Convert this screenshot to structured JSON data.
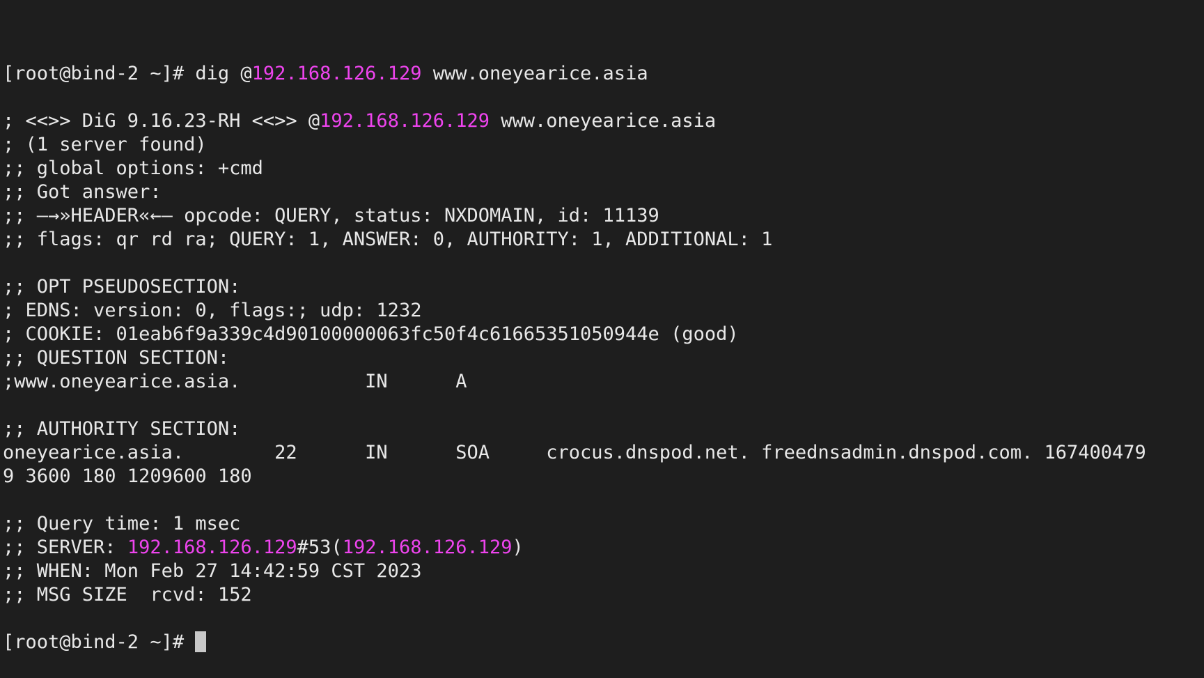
{
  "colors": {
    "background": "#1e1e1e",
    "text": "#e8e8e8",
    "ip_highlight": "#ee44ee",
    "cursor": "#c8c8c8"
  },
  "terminal": {
    "lines": [
      [
        {
          "t": "[root@bind-2 ~]# dig @"
        },
        {
          "t": "192.168.126.129",
          "c": "ip"
        },
        {
          "t": " www.oneyearice.asia"
        }
      ],
      [],
      [
        {
          "t": "; <<>> DiG 9.16.23-RH <<>> @"
        },
        {
          "t": "192.168.126.129",
          "c": "ip"
        },
        {
          "t": " www.oneyearice.asia"
        }
      ],
      [
        {
          "t": "; (1 server found)"
        }
      ],
      [
        {
          "t": ";; global options: +cmd"
        }
      ],
      [
        {
          "t": ";; Got answer:"
        }
      ],
      [
        {
          "t": ";; —→»HEADER«←— opcode: QUERY, status: NXDOMAIN, id: 11139"
        }
      ],
      [
        {
          "t": ";; flags: qr rd ra; QUERY: 1, ANSWER: 0, AUTHORITY: 1, ADDITIONAL: 1"
        }
      ],
      [],
      [
        {
          "t": ";; OPT PSEUDOSECTION:"
        }
      ],
      [
        {
          "t": "; EDNS: version: 0, flags:; udp: 1232"
        }
      ],
      [
        {
          "t": "; COOKIE: 01eab6f9a339c4d90100000063fc50f4c61665351050944e (good)"
        }
      ],
      [
        {
          "t": ";; QUESTION SECTION:"
        }
      ],
      [
        {
          "t": ";www.oneyearice.asia.           IN      A"
        }
      ],
      [],
      [
        {
          "t": ";; AUTHORITY SECTION:"
        }
      ],
      [
        {
          "t": "oneyearice.asia.        22      IN      SOA     crocus.dnspod.net. freednsadmin.dnspod.com. 167400479"
        }
      ],
      [
        {
          "t": "9 3600 180 1209600 180"
        }
      ],
      [],
      [
        {
          "t": ";; Query time: 1 msec"
        }
      ],
      [
        {
          "t": ";; SERVER: "
        },
        {
          "t": "192.168.126.129",
          "c": "ip"
        },
        {
          "t": "#53("
        },
        {
          "t": "192.168.126.129",
          "c": "ip"
        },
        {
          "t": ")"
        }
      ],
      [
        {
          "t": ";; WHEN: Mon Feb 27 14:42:59 CST 2023"
        }
      ],
      [
        {
          "t": ";; MSG SIZE  rcvd: 152"
        }
      ],
      [],
      [
        {
          "t": "[root@bind-2 ~]# "
        }
      ]
    ]
  }
}
